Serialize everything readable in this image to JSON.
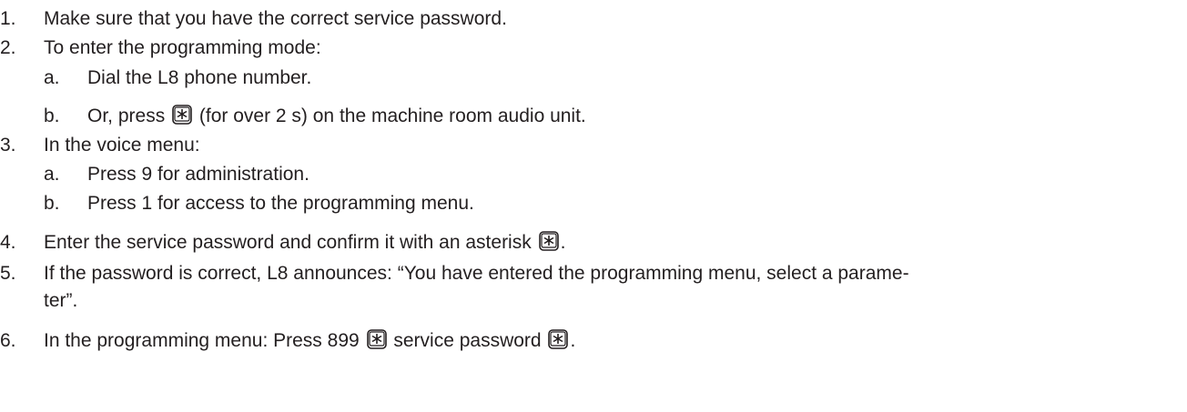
{
  "steps": [
    {
      "num": "1.",
      "text": "Make sure that you have the correct service password."
    },
    {
      "num": "2.",
      "text": "To enter the programming mode:",
      "substeps": [
        {
          "letter": "a.",
          "text": "Dial the L8 phone number."
        },
        {
          "letter": "b.",
          "text_before": "Or, press",
          "text_after": "(for over 2 s) on the machine room audio unit."
        }
      ]
    },
    {
      "num": "3.",
      "text": "In the voice menu:",
      "substeps": [
        {
          "letter": "a.",
          "text": "Press 9 for administration."
        },
        {
          "letter": "b.",
          "text": "Press 1 for access to the programming menu."
        }
      ]
    },
    {
      "num": "4.",
      "text_before": "Enter the service password and confirm it with an asterisk",
      "text_after": "."
    },
    {
      "num": "5.",
      "text_line1": "If the password is correct, L8 announces: “You have entered the programming menu, select a parame-",
      "text_line2": "ter”."
    },
    {
      "num": "6.",
      "text_before": "In the programming menu: Press 899",
      "text_middle": "service password",
      "text_after": "."
    }
  ],
  "icons": {
    "asterisk_key": "asterisk-key-icon"
  }
}
